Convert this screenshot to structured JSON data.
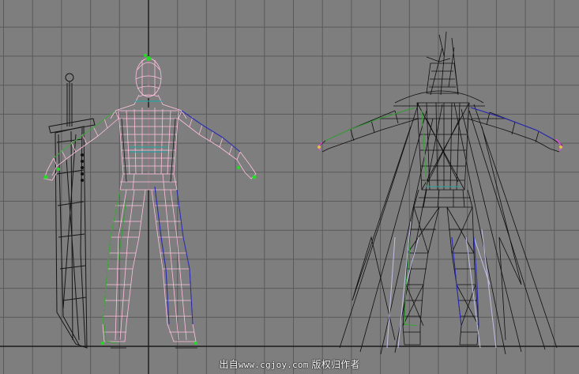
{
  "viewport": {
    "type": "3d-wireframe-viewport",
    "background_color": "#7e7e7e",
    "grid_line_color": "#5a5a5a",
    "axis_color": "#1a1a1a",
    "grid_visible": true
  },
  "models": [
    {
      "name": "character-with-sword",
      "view": "front",
      "mesh_color": "#ffb8d8",
      "wire_colors": [
        "#ffb8d8",
        "#3a9a3a",
        "#2a2aaa",
        "#2aa0a0",
        "#101010"
      ]
    },
    {
      "name": "character-with-cape",
      "view": "front",
      "mesh_color": "#111111",
      "wire_colors": [
        "#111111",
        "#3a9a3a",
        "#2a2aaa",
        "#b0b0d8",
        "#ff40ff"
      ]
    }
  ],
  "watermark": {
    "prefix": "出自",
    "site": "www.cgjoy.com",
    "suffix": "版权归作者"
  }
}
